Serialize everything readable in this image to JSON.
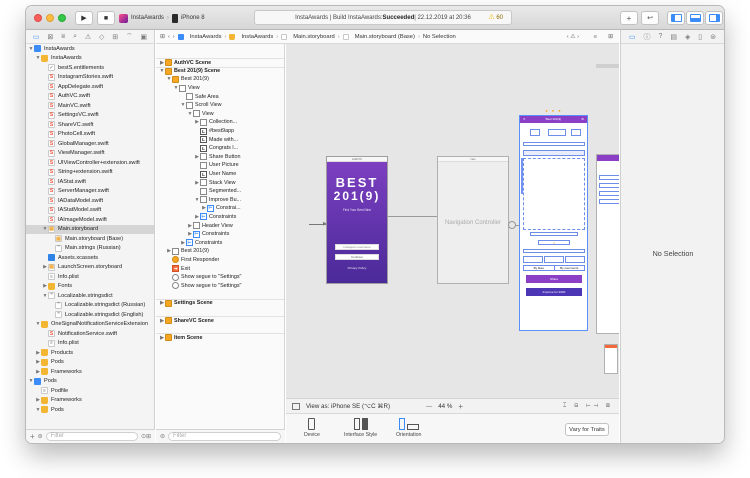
{
  "window": {
    "scheme": "InstaAwards",
    "device": "iPhone 8",
    "activity_prefix": "InstaAwards | Build InstaAwards: ",
    "activity_status": "Succeeded",
    "activity_date": " | 22.12.2019 at 20:36",
    "warnings": "60"
  },
  "toolbar": {
    "stop": "■",
    "run": "▶",
    "plus": "+",
    "code_review": "↩",
    "accent": "#3b8cf6"
  },
  "navigator": {
    "tabs": [
      "▭",
      "⊠",
      "⩸",
      "⌕",
      "⚠",
      "◇",
      "⊞",
      "⌔",
      "▣"
    ],
    "items": [
      {
        "label": "InstaAwards",
        "icon": "proj",
        "depth": 0,
        "disc": "▼"
      },
      {
        "label": "InstaAwards",
        "icon": "folder",
        "depth": 1,
        "disc": "▼"
      },
      {
        "label": "bestS.entitlements",
        "icon": "ent",
        "depth": 2,
        "disc": ""
      },
      {
        "label": "InstagramStories.swift",
        "icon": "swift",
        "depth": 2,
        "disc": ""
      },
      {
        "label": "AppDelegate.swift",
        "icon": "swift",
        "depth": 2,
        "disc": ""
      },
      {
        "label": "AuthVC.swift",
        "icon": "swift",
        "depth": 2,
        "disc": ""
      },
      {
        "label": "MainVC.swift",
        "icon": "swift",
        "depth": 2,
        "disc": ""
      },
      {
        "label": "SettingsVC.swift",
        "icon": "swift",
        "depth": 2,
        "disc": ""
      },
      {
        "label": "ShareVC.swift",
        "icon": "swift",
        "depth": 2,
        "disc": ""
      },
      {
        "label": "PhotoCell.swift",
        "icon": "swift",
        "depth": 2,
        "disc": ""
      },
      {
        "label": "GlobalManager.swift",
        "icon": "swift",
        "depth": 2,
        "disc": ""
      },
      {
        "label": "ViewManager.swift",
        "icon": "swift",
        "depth": 2,
        "disc": ""
      },
      {
        "label": "UIViewController+extension.swift",
        "icon": "swift",
        "depth": 2,
        "disc": ""
      },
      {
        "label": "String+extension.swift",
        "icon": "swift",
        "depth": 2,
        "disc": ""
      },
      {
        "label": "IAStat.swift",
        "icon": "swift",
        "depth": 2,
        "disc": ""
      },
      {
        "label": "ServerManager.swift",
        "icon": "swift",
        "depth": 2,
        "disc": ""
      },
      {
        "label": "IADataModel.swift",
        "icon": "swift",
        "depth": 2,
        "disc": ""
      },
      {
        "label": "IAStatModel.swift",
        "icon": "swift",
        "depth": 2,
        "disc": ""
      },
      {
        "label": "IAImageModel.swift",
        "icon": "swift",
        "depth": 2,
        "disc": ""
      },
      {
        "label": "Main.storyboard",
        "icon": "sb",
        "depth": 2,
        "disc": "▼",
        "selected": true
      },
      {
        "label": "Main.storyboard (Base)",
        "icon": "sb",
        "depth": 3,
        "disc": ""
      },
      {
        "label": "Main.strings (Russian)",
        "icon": "str",
        "depth": 3,
        "disc": ""
      },
      {
        "label": "Assets.xcassets",
        "icon": "xc",
        "depth": 2,
        "disc": ""
      },
      {
        "label": "LaunchScreen.storyboard",
        "icon": "sb",
        "depth": 2,
        "disc": "▶"
      },
      {
        "label": "Info.plist",
        "icon": "plist",
        "depth": 2,
        "disc": ""
      },
      {
        "label": "Fonts",
        "icon": "folder",
        "depth": 2,
        "disc": "▶"
      },
      {
        "label": "Localizable.stringsdict",
        "icon": "str",
        "depth": 2,
        "disc": "▼"
      },
      {
        "label": "Localizable.stringsdict (Russian)",
        "icon": "str",
        "depth": 3,
        "disc": ""
      },
      {
        "label": "Localizable.stringsdict (English)",
        "icon": "str",
        "depth": 3,
        "disc": ""
      },
      {
        "label": "OneSignalNotificationServiceExtension",
        "icon": "folder",
        "depth": 1,
        "disc": "▼"
      },
      {
        "label": "NotificationService.swift",
        "icon": "swift",
        "depth": 2,
        "disc": ""
      },
      {
        "label": "Info.plist",
        "icon": "plist",
        "depth": 2,
        "disc": ""
      },
      {
        "label": "Products",
        "icon": "folder",
        "depth": 1,
        "disc": "▶"
      },
      {
        "label": "Pods",
        "icon": "folder",
        "depth": 1,
        "disc": "▶"
      },
      {
        "label": "Frameworks",
        "icon": "folder",
        "depth": 1,
        "disc": "▶"
      },
      {
        "label": "Pods",
        "icon": "proj",
        "depth": 0,
        "disc": "▼"
      },
      {
        "label": "Podfile",
        "icon": "plist",
        "depth": 1,
        "disc": ""
      },
      {
        "label": "Frameworks",
        "icon": "folder",
        "depth": 1,
        "disc": "▶"
      },
      {
        "label": "Pods",
        "icon": "folder",
        "depth": 1,
        "disc": "▼"
      }
    ],
    "filter_placeholder": "Filter"
  },
  "jumpbar": {
    "crumbs": [
      "InstaAwards",
      "InstaAwards",
      "Main.storyboard",
      "Main.storyboard (Base)",
      "No Selection"
    ]
  },
  "outline": {
    "items": [
      {
        "label": "AuthVC Scene",
        "icon": "vc",
        "depth": 0,
        "disc": "▶",
        "scene": true
      },
      {
        "label": "Best 201(9) Scene",
        "icon": "vc",
        "depth": 0,
        "disc": "▼",
        "scene": true
      },
      {
        "label": "Best 201(9)",
        "icon": "vc",
        "depth": 1,
        "disc": "▼"
      },
      {
        "label": "View",
        "icon": "box",
        "depth": 2,
        "disc": "▼"
      },
      {
        "label": "Safe Area",
        "icon": "box",
        "depth": 3,
        "disc": ""
      },
      {
        "label": "Scroll View",
        "icon": "box",
        "depth": 3,
        "disc": "▼"
      },
      {
        "label": "View",
        "icon": "box",
        "depth": 4,
        "disc": "▼"
      },
      {
        "label": "Collection...",
        "icon": "box",
        "depth": 5,
        "disc": "▶"
      },
      {
        "label": "#best9app",
        "icon": "lbl",
        "depth": 5,
        "disc": ""
      },
      {
        "label": "Made with...",
        "icon": "lbl",
        "depth": 5,
        "disc": ""
      },
      {
        "label": "Congrats l...",
        "icon": "lbl",
        "depth": 5,
        "disc": ""
      },
      {
        "label": "Share Button",
        "icon": "box",
        "depth": 5,
        "disc": "▶"
      },
      {
        "label": "User Picture",
        "icon": "box",
        "depth": 5,
        "disc": ""
      },
      {
        "label": "User Name",
        "icon": "lbl",
        "depth": 5,
        "disc": ""
      },
      {
        "label": "Stack View",
        "icon": "box",
        "depth": 5,
        "disc": "▶"
      },
      {
        "label": "Segmented...",
        "icon": "box",
        "depth": 5,
        "disc": ""
      },
      {
        "label": "Improve Bu...",
        "icon": "box",
        "depth": 5,
        "disc": "▼"
      },
      {
        "label": "Constrai...",
        "icon": "con",
        "depth": 6,
        "disc": "▶"
      },
      {
        "label": "Constraints",
        "icon": "con",
        "depth": 5,
        "disc": "▶"
      },
      {
        "label": "Header View",
        "icon": "box",
        "depth": 4,
        "disc": "▶"
      },
      {
        "label": "Constraints",
        "icon": "con",
        "depth": 4,
        "disc": "▶"
      },
      {
        "label": "Constraints",
        "icon": "con",
        "depth": 3,
        "disc": "▶"
      },
      {
        "label": "Best 201(9)",
        "icon": "box",
        "depth": 1,
        "disc": "▶"
      },
      {
        "label": "First Responder",
        "icon": "fr",
        "depth": 1,
        "disc": ""
      },
      {
        "label": "Exit",
        "icon": "exit",
        "depth": 1,
        "disc": ""
      },
      {
        "label": "Show segue to \"Settings\"",
        "icon": "seg",
        "depth": 1,
        "disc": ""
      },
      {
        "label": "Show segue to \"Settings\"",
        "icon": "seg",
        "depth": 1,
        "disc": ""
      },
      {
        "label": "",
        "icon": "",
        "depth": 0,
        "disc": ""
      },
      {
        "label": "Settings Scene",
        "icon": "vc",
        "depth": 0,
        "disc": "▶",
        "scene": true
      },
      {
        "label": "",
        "icon": "",
        "depth": 0,
        "disc": ""
      },
      {
        "label": "ShareVC Scene",
        "icon": "vc",
        "depth": 0,
        "disc": "▶",
        "scene": true
      },
      {
        "label": "",
        "icon": "",
        "depth": 0,
        "disc": ""
      },
      {
        "label": "Item Scene",
        "icon": "vc",
        "depth": 0,
        "disc": "▶",
        "scene": true
      }
    ],
    "filter_placeholder": "Filter"
  },
  "canvas": {
    "auth_scene": {
      "title_line1": "BEST",
      "title_line2": "201(9)",
      "subtitle": "Find Your Best Nine",
      "field": "Instagram username",
      "continue": "Continue",
      "privacy": "Privacy Policy"
    },
    "nav_controller_label": "Navigation Controller",
    "main_scene": {
      "title": "Best 201(9)",
      "share": "Share",
      "improve": "Improve for 2020",
      "seg_left": "By likes",
      "seg_right": "By comments"
    },
    "view_as": "View as: iPhone SE (⌥C ⌘R)",
    "zoom": "44 %",
    "zoom_minus": "—",
    "zoom_plus": "+"
  },
  "traits": {
    "device": "Device",
    "interface_style": "Interface Style",
    "orientation": "Orientation",
    "vary": "Vary for Traits"
  },
  "inspector": {
    "no_selection": "No Selection"
  }
}
